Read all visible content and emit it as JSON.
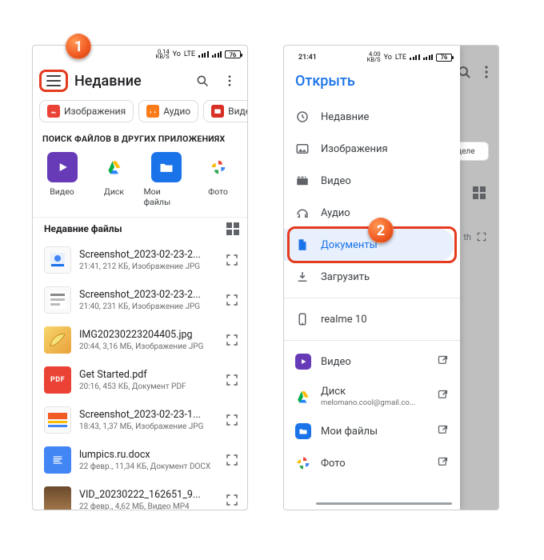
{
  "callouts": {
    "one": "1",
    "two": "2"
  },
  "left": {
    "status": {
      "speed_value": "0.14",
      "speed_unit": "KB/S",
      "carrier": "Yo",
      "net": "LTE",
      "battery": "76"
    },
    "title": "Недавние",
    "chips": [
      {
        "icon": "image",
        "label": "Изображения"
      },
      {
        "icon": "audio",
        "label": "Аудио"
      },
      {
        "icon": "video",
        "label": "Видео"
      }
    ],
    "apps_label": "ПОИСК ФАЙЛОВ В ДРУГИХ ПРИЛОЖЕНИЯХ",
    "apps": [
      {
        "label": "Видео",
        "color": "#673ab7"
      },
      {
        "label": "Диск",
        "color": ""
      },
      {
        "label": "Мои файлы",
        "color": "#1a73e8"
      },
      {
        "label": "Фото",
        "color": ""
      }
    ],
    "recent_label": "Недавние файлы",
    "files": [
      {
        "name": "Screenshot_2023-02-23-2...",
        "meta": "21:41, 212 КБ, Изображение JPG",
        "thumb": "pic1"
      },
      {
        "name": "Screenshot_2023-02-23-2...",
        "meta": "21:40, 231 КБ, Изображение JPG",
        "thumb": "pic2"
      },
      {
        "name": "IMG20230223204405.jpg",
        "meta": "20:44, 3,16 МБ, Изображение JPG",
        "thumb": "banana"
      },
      {
        "name": "Get Started.pdf",
        "meta": "20:16, 453 КБ, Документ PDF",
        "thumb": "pdf"
      },
      {
        "name": "Screenshot_2023-02-23-1...",
        "meta": "18:43, 1,37 МБ, Изображение JPG",
        "thumb": "pic3"
      },
      {
        "name": "lumpics.ru.docx",
        "meta": "22 февр., 11,34 КБ, Документ DOCX",
        "thumb": "docx"
      },
      {
        "name": "VID_20230222_162651_9...",
        "meta": "22 февр., 4,62 МБ, Видео MP4",
        "thumb": "vid"
      }
    ]
  },
  "right": {
    "status": {
      "time": "21:41",
      "speed_value": "4.00",
      "speed_unit": "KB/S",
      "carrier": "Yo",
      "net": "LTE",
      "battery": "76"
    },
    "drawer_title": "Открыть",
    "under_week": "неделе",
    "under_th": "th",
    "items": [
      {
        "icon": "recent",
        "label": "Недавние"
      },
      {
        "icon": "image",
        "label": "Изображения"
      },
      {
        "icon": "video",
        "label": "Видео"
      },
      {
        "icon": "audio",
        "label": "Аудио"
      },
      {
        "icon": "doc",
        "label": "Документы",
        "active": true
      },
      {
        "icon": "download",
        "label": "Загрузить"
      }
    ],
    "device": {
      "label": "realme 10"
    },
    "shortcuts": [
      {
        "icon": "video-app",
        "label": "Видео",
        "sub": ""
      },
      {
        "icon": "drive",
        "label": "Диск",
        "sub": "melomano.cool@gmail.co..."
      },
      {
        "icon": "files",
        "label": "Мои файлы",
        "sub": ""
      },
      {
        "icon": "photos",
        "label": "Фото",
        "sub": ""
      }
    ]
  }
}
